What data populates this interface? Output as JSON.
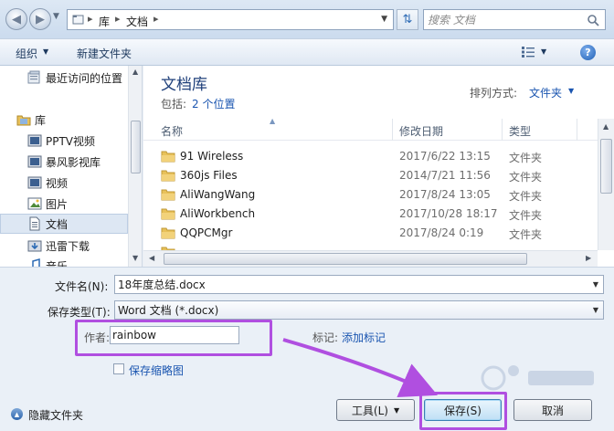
{
  "address_bar": {
    "breadcrumbs": [
      "库",
      "文档"
    ],
    "search_placeholder": "搜索 文档"
  },
  "toolbar": {
    "organize": "组织",
    "new_folder": "新建文件夹"
  },
  "nav": {
    "items": [
      {
        "label": "最近访问的位置",
        "icon": "recent-places-icon"
      },
      {
        "label": "库",
        "icon": "library-icon"
      },
      {
        "label": "PPTV视频",
        "icon": "video-library-icon"
      },
      {
        "label": "暴风影视库",
        "icon": "video-library-icon"
      },
      {
        "label": "视频",
        "icon": "video-library-icon"
      },
      {
        "label": "图片",
        "icon": "pictures-library-icon"
      },
      {
        "label": "文档",
        "icon": "documents-library-icon"
      },
      {
        "label": "迅雷下载",
        "icon": "download-library-icon"
      },
      {
        "label": "音乐",
        "icon": "music-library-icon"
      }
    ]
  },
  "library": {
    "title": "文档库",
    "includes_label": "包括:",
    "includes_link": "2 个位置",
    "arrange_label": "排列方式:",
    "arrange_value": "文件夹"
  },
  "columns": {
    "name": "名称",
    "modified": "修改日期",
    "type": "类型"
  },
  "files": [
    {
      "name": "91 Wireless",
      "date": "2017/6/22 13:15",
      "type": "文件夹"
    },
    {
      "name": "360js Files",
      "date": "2014/7/21 11:56",
      "type": "文件夹"
    },
    {
      "name": "AliWangWang",
      "date": "2017/8/24 13:05",
      "type": "文件夹"
    },
    {
      "name": "AliWorkbench",
      "date": "2017/10/28 18:17",
      "type": "文件夹"
    },
    {
      "name": "QQPCMgr",
      "date": "2017/8/24 0:19",
      "type": "文件夹"
    }
  ],
  "form": {
    "filename_label": "文件名(N):",
    "filename_value": "18年度总结.docx",
    "savetype_label": "保存类型(T):",
    "savetype_value": "Word 文档 (*.docx)",
    "author_label": "作者:",
    "author_value": "rainbow",
    "tags_label": "标记:",
    "tags_link": "添加标记",
    "thumbnail_label": "保存缩略图"
  },
  "footer": {
    "hide_folders": "隐藏文件夹",
    "tools": "工具(L)",
    "save": "保存(S)",
    "cancel": "取消"
  },
  "colors": {
    "annotation": "#b04fe0",
    "link": "#1a55b0",
    "folder": "#e8c15a"
  }
}
